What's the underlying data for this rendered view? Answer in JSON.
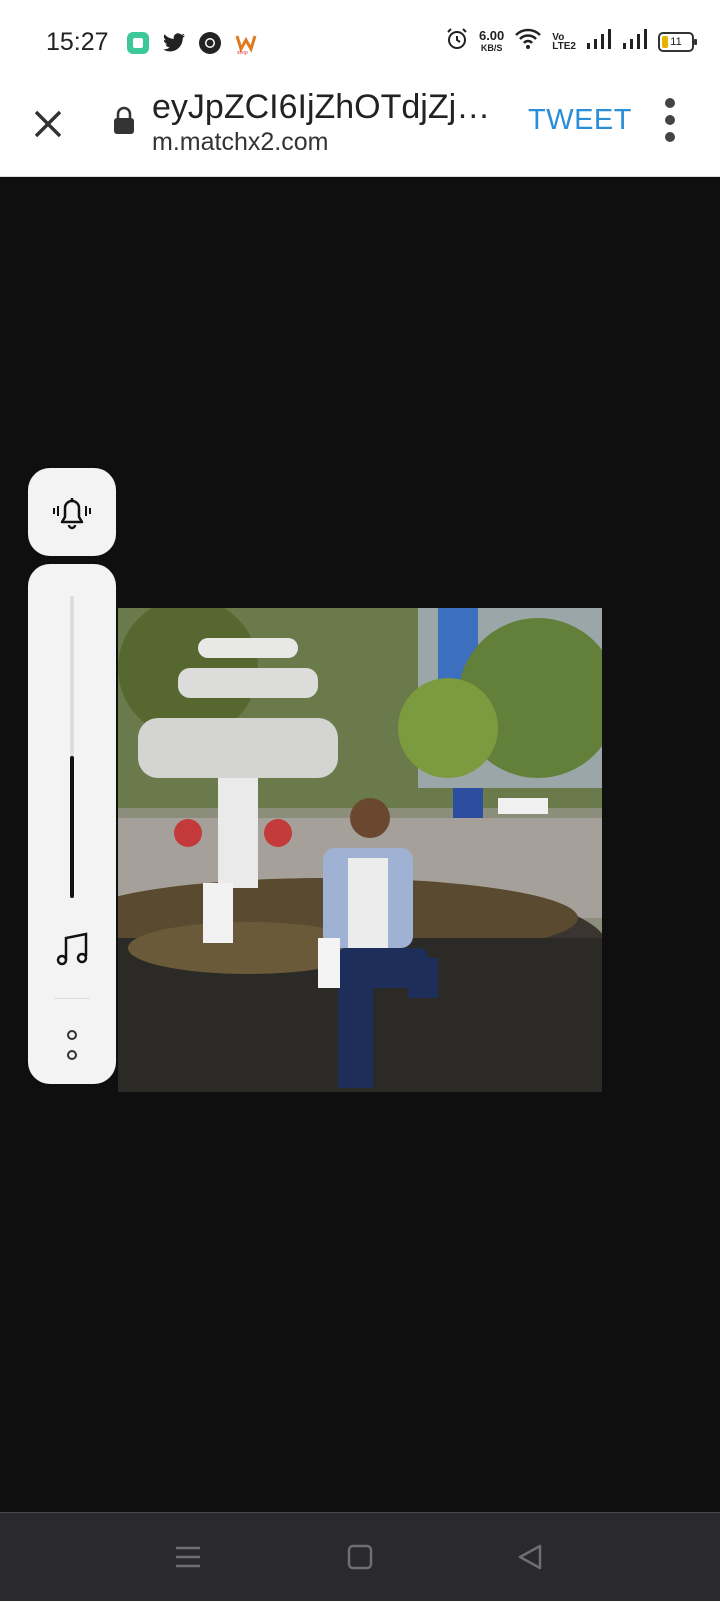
{
  "status_bar": {
    "time": "15:27",
    "notification_icons": [
      "app-icon",
      "twitter-icon",
      "chrome-icon",
      "shopping-icon"
    ],
    "speed_value": "6.00",
    "speed_unit": "KB/S",
    "volte_label": "Vo\nLTE2",
    "battery_level": "11"
  },
  "toolbar": {
    "page_title": "eyJpZCI6IjZhOTdjZjZ…",
    "domain": "m.matchx2.com",
    "tweet_label": "TWEET"
  },
  "volume_panel": {
    "level": 0.47
  },
  "colors": {
    "accent": "#2a8fd6",
    "background": "#0f0f10",
    "navbar": "#2a2a2e"
  },
  "photo": {
    "alt": ""
  }
}
